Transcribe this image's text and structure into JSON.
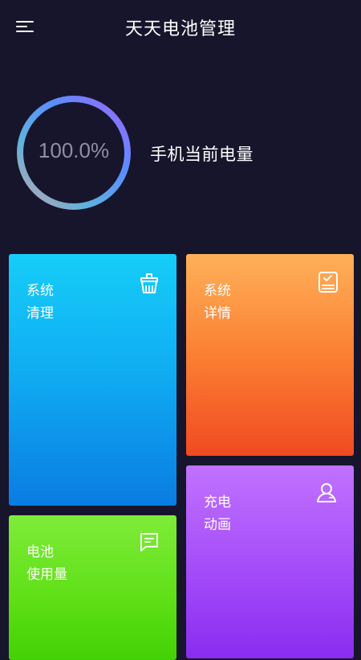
{
  "header": {
    "title": "天天电池管理",
    "menu_icon": "menu-icon"
  },
  "battery": {
    "percent_text": "100.0%",
    "level": 1.0,
    "label": "手机当前电量",
    "ring_colors": [
      "#9b6bff",
      "#4fa5ff",
      "#6ab4d8",
      "#c4a0a8"
    ]
  },
  "cards": {
    "clean": {
      "line1": "系统",
      "line2": "清理",
      "icon": "broom-basket-icon",
      "color": "#12b4f4"
    },
    "detail": {
      "line1": "系统",
      "line2": "详情",
      "icon": "checklist-tablet-icon",
      "color": "#fb8a38"
    },
    "anim": {
      "line1": "充电",
      "line2": "动画",
      "icon": "user-icon",
      "color": "#a452f8"
    },
    "usage": {
      "line1": "电池",
      "line2": "使用量",
      "icon": "message-icon",
      "color": "#62e11a"
    }
  }
}
